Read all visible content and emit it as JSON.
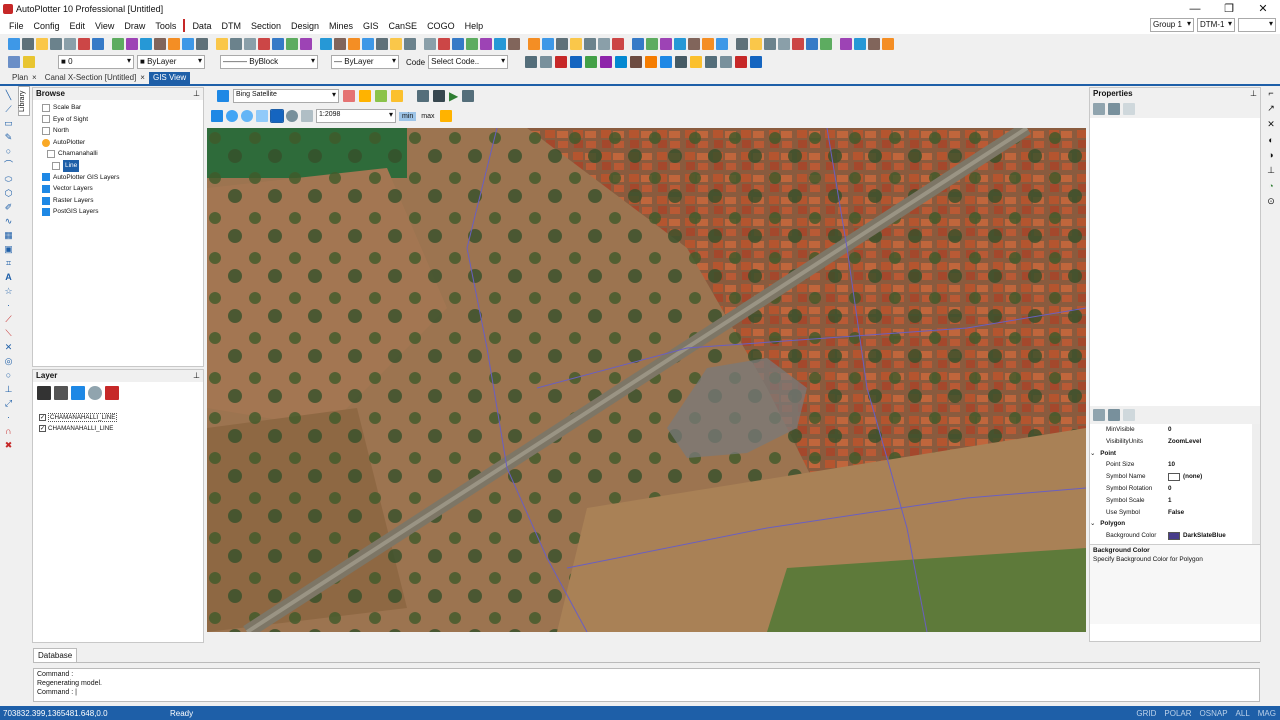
{
  "window": {
    "title": "AutoPlotter 10 Professional [Untitled]",
    "minimize": "—",
    "maximize": "❐",
    "close": "✕"
  },
  "menu": {
    "items": [
      "File",
      "Config",
      "Edit",
      "View",
      "Draw",
      "Tools"
    ],
    "items2": [
      "Data",
      "DTM",
      "Section",
      "Design",
      "Mines",
      "GIS",
      "CanSE",
      "COGO",
      "Help"
    ],
    "group_select": "Group 1",
    "dtm_select": "DTM-1"
  },
  "toolbar2": {
    "layer_value": "0",
    "color_value": "ByLayer",
    "linetype_value": "ByBlock",
    "lineweight_value": "ByLayer",
    "code_label": "Code",
    "code_value": "Select Code.."
  },
  "doc_tabs": [
    {
      "label": "Plan",
      "close": "×"
    },
    {
      "label": "Canal X-Section [Untitled]",
      "close": "×"
    },
    {
      "label": "GIS View",
      "close": ""
    }
  ],
  "browse": {
    "title": "Browse",
    "vertical_tab": "Library",
    "items": [
      {
        "label": "Scale Bar",
        "indent": 1
      },
      {
        "label": "Eye of Sight",
        "indent": 1
      },
      {
        "label": "North",
        "indent": 1
      },
      {
        "label": "AutoPlotter",
        "indent": 1
      },
      {
        "label": "Chamanahalli",
        "indent": 2
      },
      {
        "label": "Line",
        "indent": 3
      },
      {
        "label": "AutoPlotter GIS Layers",
        "indent": 1
      },
      {
        "label": "Vector Layers",
        "indent": 1
      },
      {
        "label": "Raster Layers",
        "indent": 1
      },
      {
        "label": "PostGIS Layers",
        "indent": 1
      }
    ]
  },
  "layer": {
    "title": "Layer",
    "items": [
      "CHAMANAHALLI_LINE",
      "CHAMANAHALLI_LINE"
    ]
  },
  "gis_toolbar": {
    "basemap": "Bing Satellite",
    "scale": "1:2098",
    "min_label": "min",
    "max_label": "max"
  },
  "properties": {
    "title": "Properties",
    "rows": [
      {
        "k": "MinVisible",
        "v": "0",
        "type": "row"
      },
      {
        "k": "VisibilityUnits",
        "v": "ZoomLevel",
        "type": "row"
      },
      {
        "k": "Point",
        "v": "",
        "type": "cat"
      },
      {
        "k": "Point Size",
        "v": "10",
        "type": "row"
      },
      {
        "k": "Symbol Name",
        "v": "(none)",
        "type": "swatch-white"
      },
      {
        "k": "Symbol Rotation",
        "v": "0",
        "type": "row"
      },
      {
        "k": "Symbol Scale",
        "v": "1",
        "type": "row"
      },
      {
        "k": "Use Symbol",
        "v": "False",
        "type": "row"
      },
      {
        "k": "Polygon",
        "v": "",
        "type": "cat"
      },
      {
        "k": "Background Color",
        "v": "DarkSlateBlue",
        "type": "swatch-blue"
      }
    ],
    "desc_title": "Background Color",
    "desc_text": "Specify Background Color for Polygon"
  },
  "database_tab": "Database",
  "command": {
    "lines": [
      "Command :",
      "  Regenerating model.",
      "Command : |"
    ]
  },
  "status": {
    "coords": "703832.399,1365481.648,0.0",
    "state": "Ready",
    "flags": [
      "GRID",
      "POLAR",
      "OSNAP",
      "ALL",
      "MAG"
    ]
  },
  "colors": {
    "accent": "#1e5fa8",
    "polygon_fill": "#483D8B"
  }
}
